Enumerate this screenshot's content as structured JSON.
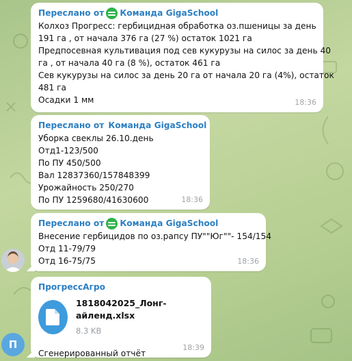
{
  "messages": [
    {
      "forwarded_prefix": "Переслано от",
      "forwarded_from": "Команда GigaSchool",
      "lines": [
        "Колхоз Прогресс: гербицидная обработка оз.пшеницы за день",
        "191 га , от начала 376 га (27 %) остаток 1021 га",
        "Предпосевная культивация под сев кукурузы на силос за день 40",
        "га , от начала 40 га (8 %), остаток 461 га",
        "Сев кукурузы на силос за день 20 га от начала 20 га (4%), остаток",
        "481 га",
        "Осадки 1 мм"
      ],
      "time": "18:36"
    },
    {
      "forwarded_prefix": "Переслано от",
      "forwarded_from": "Команда GigaSchool",
      "lines": [
        "Уборка свеклы 26.10.день",
        "Отд1-123/500",
        "По ПУ 450/500",
        "Вал 12837360/157848399",
        "Урожайность 250/270",
        "По ПУ 1259680/41630600"
      ],
      "time": "18:36"
    },
    {
      "forwarded_prefix": "Переслано от",
      "forwarded_from": "Команда GigaSchool",
      "lines": [
        "Внесение гербицидов по оз.рапсу ПУ\"\"Юг\"\"- 154/154",
        "Отд 11-79/79",
        "Отд 16-75/75"
      ],
      "time": "18:36"
    },
    {
      "sender": "ПрогрессАгро",
      "file_name": "1818042025_Лонг-айленд.xlsx",
      "file_size": "8.3 KB",
      "caption": "Сгенерированный отчёт",
      "time": "18:39",
      "avatar_letter": "П"
    }
  ],
  "colors": {
    "accent": "#2c7fc2",
    "gigaschool_green": "#2fb34a",
    "file_icon": "#3e9bdc",
    "avatar_p": "#5aa7e0"
  }
}
